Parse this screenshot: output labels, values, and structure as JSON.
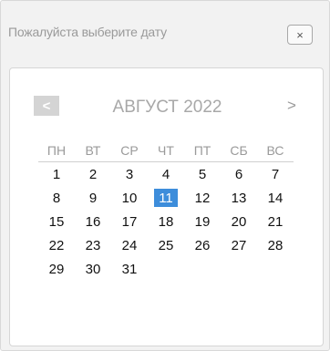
{
  "header": {
    "title": "Пожалуйста выберите дату",
    "close_label": "×"
  },
  "calendar": {
    "prev_label": "<",
    "next_label": ">",
    "month_title": "АВГУСТ 2022",
    "weekdays": [
      "ПН",
      "ВТ",
      "СР",
      "ЧТ",
      "ПТ",
      "СБ",
      "ВС"
    ],
    "days": [
      1,
      2,
      3,
      4,
      5,
      6,
      7,
      8,
      9,
      10,
      11,
      12,
      13,
      14,
      15,
      16,
      17,
      18,
      19,
      20,
      21,
      22,
      23,
      24,
      25,
      26,
      27,
      28,
      29,
      30,
      31
    ],
    "selected_day": 11,
    "accent_color": "#3d8ddb"
  }
}
